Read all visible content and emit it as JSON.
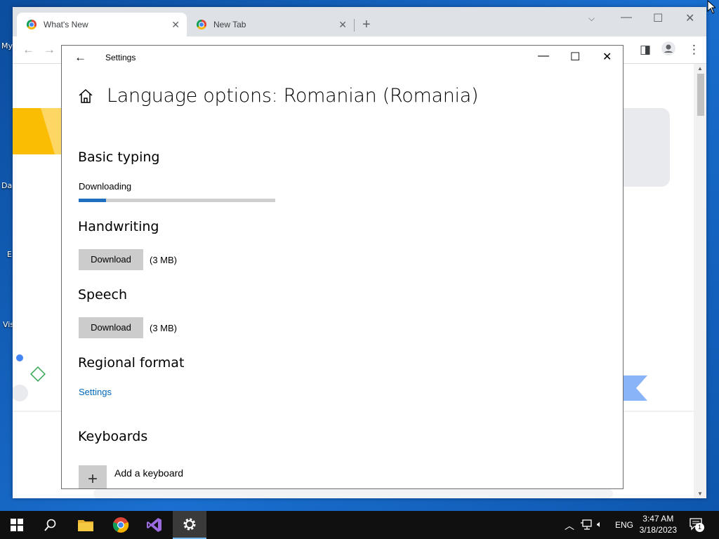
{
  "desktop": {
    "icon_labels": [
      "My",
      "Da",
      "E",
      "Vis"
    ]
  },
  "chrome": {
    "tabs": [
      {
        "title": "What's New",
        "active": true
      },
      {
        "title": "New Tab",
        "active": false
      }
    ]
  },
  "settings": {
    "window_title": "Settings",
    "page_heading": "Language options: Romanian (Romania)",
    "basic_typing": {
      "title": "Basic typing",
      "status": "Downloading",
      "progress_fraction": 0.14
    },
    "handwriting": {
      "title": "Handwriting",
      "button": "Download",
      "size": "(3 MB)"
    },
    "speech": {
      "title": "Speech",
      "button": "Download",
      "size": "(3 MB)"
    },
    "regional_format": {
      "title": "Regional format",
      "link": "Settings"
    },
    "keyboards": {
      "title": "Keyboards",
      "add_label": "Add a keyboard"
    }
  },
  "taskbar": {
    "language": "ENG",
    "time": "3:47 AM",
    "date": "3/18/2023",
    "notification_count": "1"
  },
  "colors": {
    "progress_fill": "#1e6fbf",
    "link": "#0067b8",
    "button_bg": "#cccccc",
    "taskbar_bg": "#101010"
  }
}
